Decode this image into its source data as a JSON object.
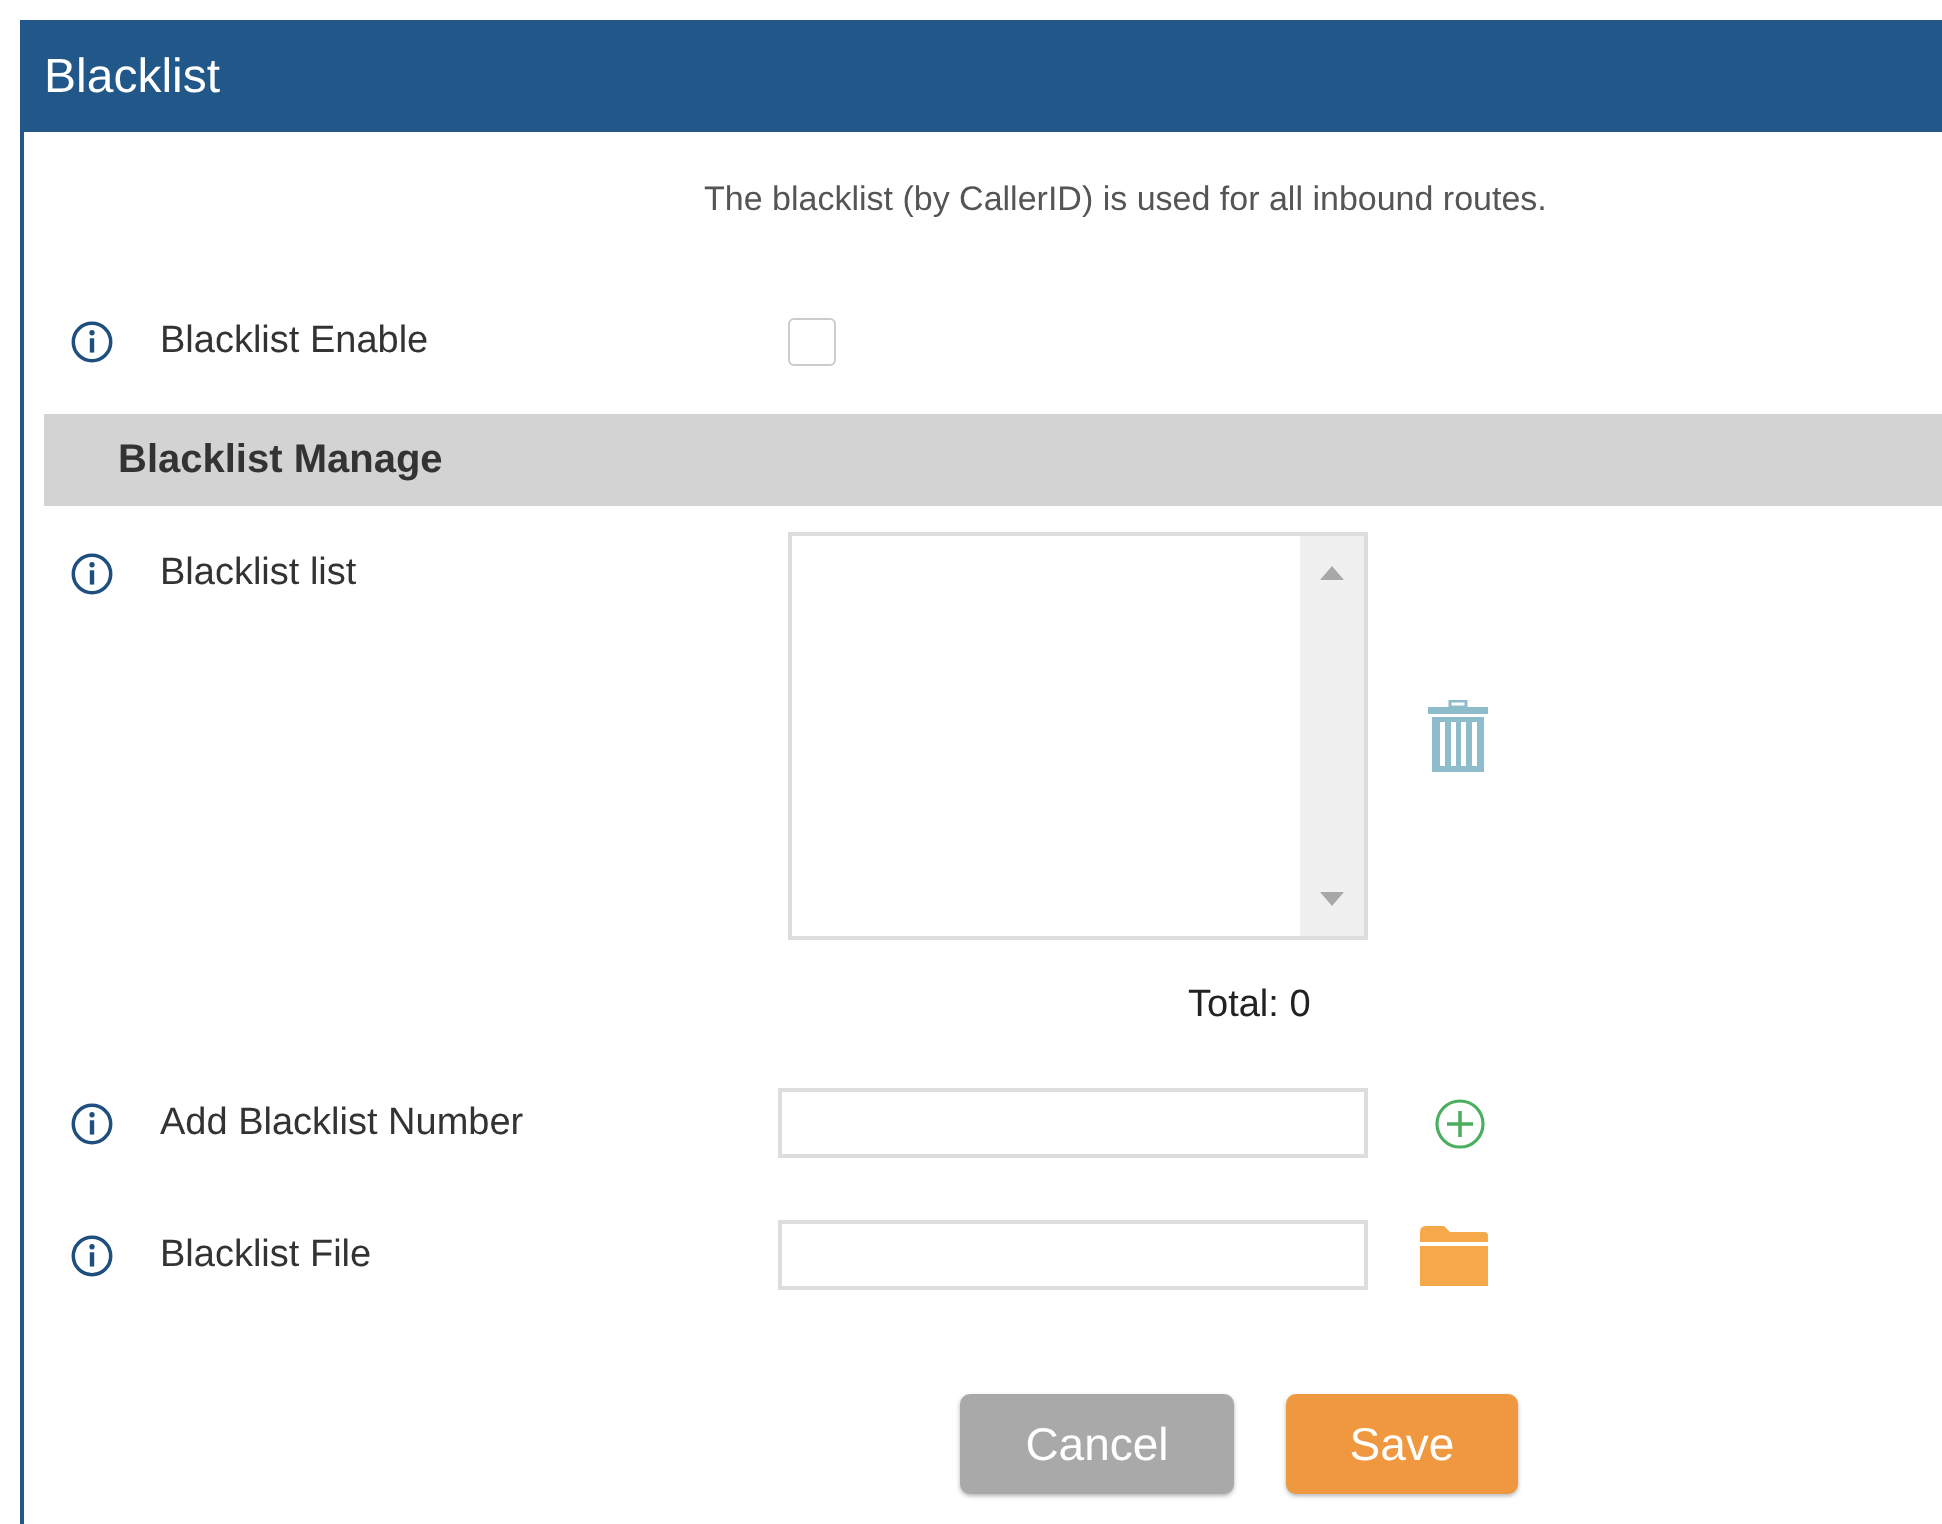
{
  "window": {
    "title": "Blacklist"
  },
  "description": "The blacklist (by CallerID) is used for all inbound routes.",
  "enable": {
    "label": "Blacklist Enable",
    "checked": false
  },
  "section": {
    "title": "Blacklist Manage"
  },
  "fields": [
    {
      "kind": "list",
      "label": "Blacklist list",
      "total": "Total: 0"
    },
    {
      "kind": "add",
      "label": "Add Blacklist Number"
    },
    {
      "kind": "file",
      "label": "Blacklist File"
    }
  ],
  "buttons": [
    {
      "kind": "cancel",
      "label": "Cancel"
    },
    {
      "kind": "save",
      "label": "Save"
    }
  ]
}
